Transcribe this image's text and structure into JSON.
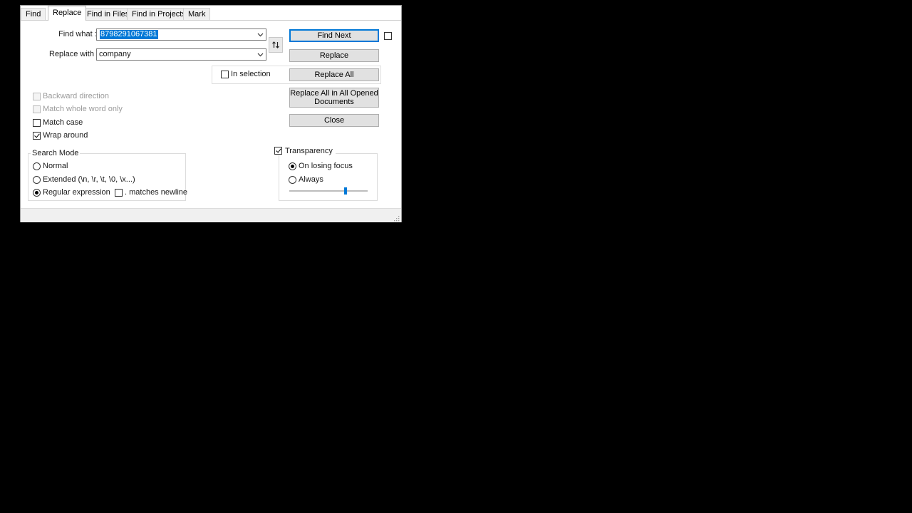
{
  "tabs": [
    "Find",
    "Replace",
    "Find in Files",
    "Find in Projects",
    "Mark"
  ],
  "active_tab": "Replace",
  "find_what": {
    "label": "Find what :",
    "value": "8798291067381"
  },
  "replace_with": {
    "label": "Replace with :",
    "value": "company"
  },
  "swap_icon": "swap-arrows-icon",
  "buttons": {
    "find_next": "Find Next",
    "replace": "Replace",
    "replace_all": "Replace All",
    "replace_all_opened_line1": "Replace All in All Opened",
    "replace_all_opened_line2": "Documents",
    "close": "Close"
  },
  "in_selection": {
    "label": "In selection",
    "checked": false
  },
  "options": {
    "backward_direction": {
      "label": "Backward direction",
      "checked": false,
      "enabled": false
    },
    "match_whole_word": {
      "label": "Match whole word only",
      "checked": false,
      "enabled": false
    },
    "match_case": {
      "label": "Match case",
      "checked": false,
      "enabled": true
    },
    "wrap_around": {
      "label": "Wrap around",
      "checked": true,
      "enabled": true
    }
  },
  "search_mode": {
    "title": "Search Mode",
    "normal": "Normal",
    "extended": "Extended (\\n, \\r, \\t, \\0, \\x...)",
    "regex": "Regular expression",
    "matches_newline": ". matches newline",
    "selected": "Regular expression"
  },
  "transparency": {
    "title": "Transparency",
    "checked": true,
    "on_losing_focus": "On losing focus",
    "always": "Always",
    "selected": "On losing focus",
    "level": 0.72
  },
  "colors": {
    "accent": "#0078d7"
  }
}
